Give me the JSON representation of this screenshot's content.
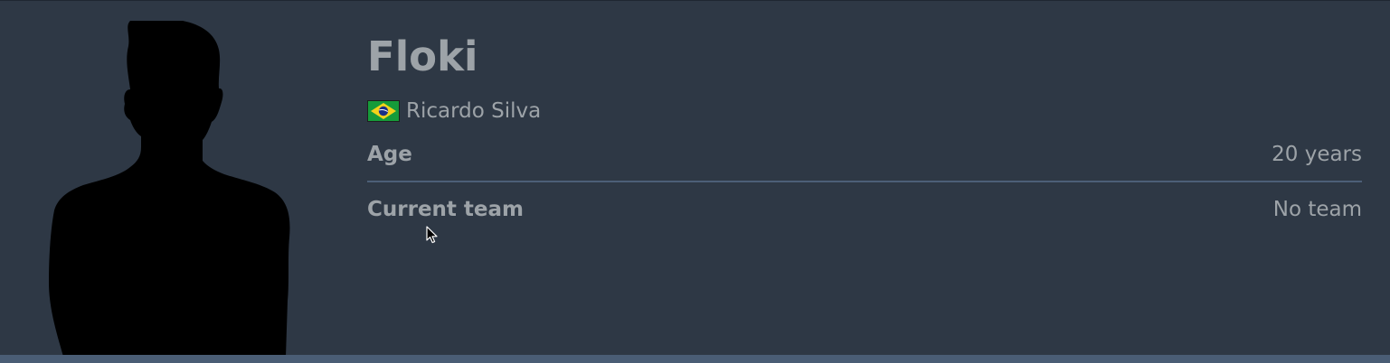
{
  "player": {
    "nickname": "Floki",
    "real_name": "Ricardo Silva",
    "country_flag_icon": "brazil-flag-icon",
    "avatar_icon": "player-silhouette-icon"
  },
  "stats": {
    "age_label": "Age",
    "age_value": "20 years",
    "team_label": "Current team",
    "team_value": "No team"
  },
  "colors": {
    "background": "#2e3845",
    "text": "#9da3a8",
    "divider": "#4c5f77",
    "bottom_bar": "#4a5d75"
  }
}
